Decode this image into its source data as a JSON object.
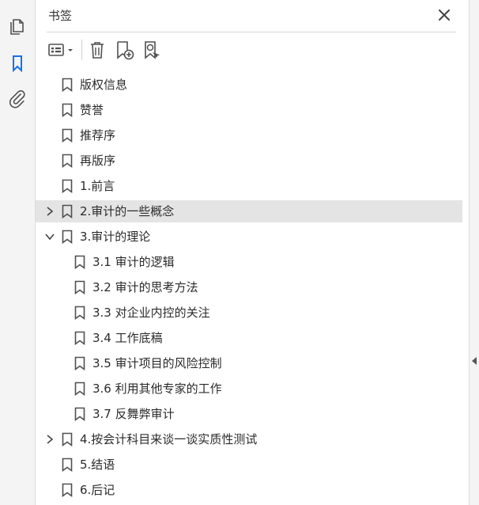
{
  "panel": {
    "title": "书签"
  },
  "rail": {
    "items": [
      {
        "icon": "pages-icon",
        "active": false
      },
      {
        "icon": "bookmark-icon",
        "active": true
      },
      {
        "icon": "paperclip-icon",
        "active": false
      }
    ]
  },
  "toolbar": {
    "buttons": [
      "options-menu-icon",
      "delete-icon",
      "new-bookmark-icon",
      "bookmark-from-selection-icon"
    ]
  },
  "bookmarks": [
    {
      "label": "版权信息",
      "level": 0,
      "expander": "none"
    },
    {
      "label": "赞誉",
      "level": 0,
      "expander": "none"
    },
    {
      "label": "推荐序",
      "level": 0,
      "expander": "none"
    },
    {
      "label": "再版序",
      "level": 0,
      "expander": "none"
    },
    {
      "label": "1.前言",
      "level": 0,
      "expander": "none"
    },
    {
      "label": "2.审计的一些概念",
      "level": 0,
      "expander": "collapsed",
      "selected": true
    },
    {
      "label": "3.审计的理论",
      "level": 0,
      "expander": "expanded"
    },
    {
      "label": "3.1 审计的逻辑",
      "level": 1,
      "expander": "none"
    },
    {
      "label": "3.2 审计的思考方法",
      "level": 1,
      "expander": "none"
    },
    {
      "label": "3.3 对企业内控的关注",
      "level": 1,
      "expander": "none"
    },
    {
      "label": "3.4 工作底稿",
      "level": 1,
      "expander": "none"
    },
    {
      "label": "3.5 审计项目的风险控制",
      "level": 1,
      "expander": "none"
    },
    {
      "label": "3.6 利用其他专家的工作",
      "level": 1,
      "expander": "none"
    },
    {
      "label": "3.7 反舞弊审计",
      "level": 1,
      "expander": "none"
    },
    {
      "label": "4.按会计科目来谈一谈实质性测试",
      "level": 0,
      "expander": "collapsed"
    },
    {
      "label": "5.结语",
      "level": 0,
      "expander": "none"
    },
    {
      "label": "6.后记",
      "level": 0,
      "expander": "none"
    }
  ],
  "colors": {
    "accent": "#1473e6",
    "icon": "#505050",
    "selected_row": "#e4e4e4"
  }
}
